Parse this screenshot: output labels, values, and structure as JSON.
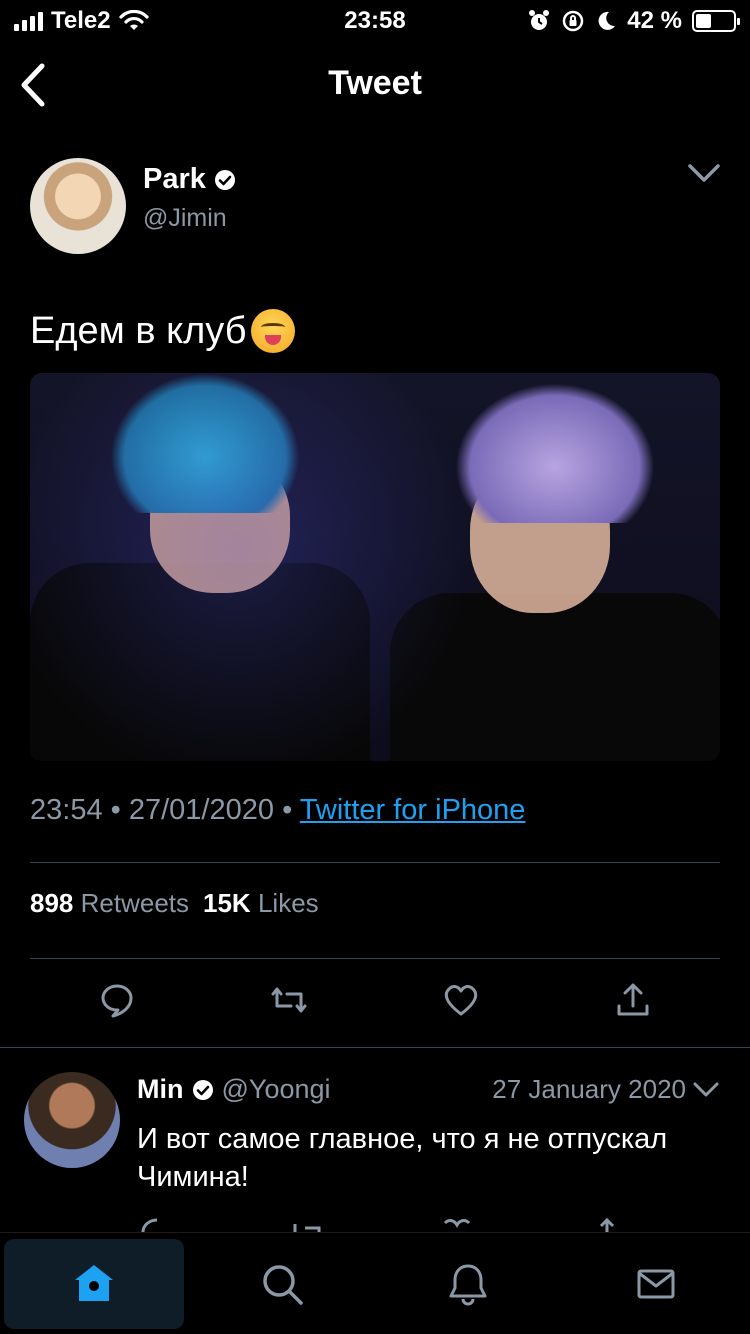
{
  "status_bar": {
    "carrier": "Tele2",
    "time": "23:58",
    "battery_percent_text": "42 %",
    "battery_level": 0.42
  },
  "nav": {
    "title": "Tweet",
    "back_icon": "chevron-left-icon"
  },
  "tweet": {
    "author_name": "Park",
    "author_handle": "@Jimin",
    "verified": true,
    "text": "Едем в клуб",
    "emoji": "face-savoring-food",
    "time": "23:54",
    "date": "27/01/2020",
    "separator": "•",
    "source": "Twitter for iPhone",
    "retweets_count": "898",
    "retweets_label": "Retweets",
    "likes_count": "15K",
    "likes_label": "Likes",
    "actions": [
      "reply-icon",
      "retweet-icon",
      "like-icon",
      "share-icon"
    ]
  },
  "reply": {
    "author_name": "Min",
    "author_handle": "@Yoongi",
    "verified": true,
    "date": "27 January 2020",
    "text": "И вот самое главное, что я не отпускал Чимина!"
  },
  "tab_bar": {
    "tabs": [
      "home-icon",
      "search-icon",
      "notifications-icon",
      "messages-icon"
    ],
    "active": "home-icon"
  },
  "colors": {
    "accent": "#1da1f2",
    "secondary_text": "#8b98a5",
    "divider": "#38444d",
    "background": "#000000"
  }
}
